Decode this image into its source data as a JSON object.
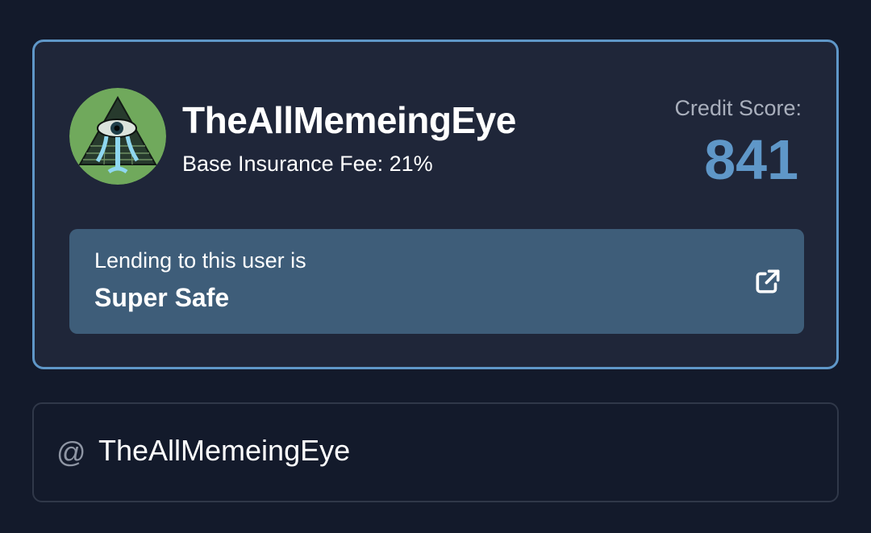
{
  "profile": {
    "username": "TheAllMemeingEye",
    "avatar_icon": "illuminati-eye-avatar",
    "fee_label": "Base Insurance Fee: 21%",
    "credit_label": "Credit Score:",
    "credit_score": "841",
    "safety_label": "Lending to this user is",
    "safety_value": "Super Safe",
    "link_icon": "external-link-icon"
  },
  "handle": {
    "prefix": "@",
    "value": "TheAllMemeingEye"
  },
  "colors": {
    "background": "#131a2b",
    "card": "#1f2639",
    "accent": "#5f97c8",
    "safety_bg": "#3e5d79",
    "muted_text": "#a9afbc"
  }
}
